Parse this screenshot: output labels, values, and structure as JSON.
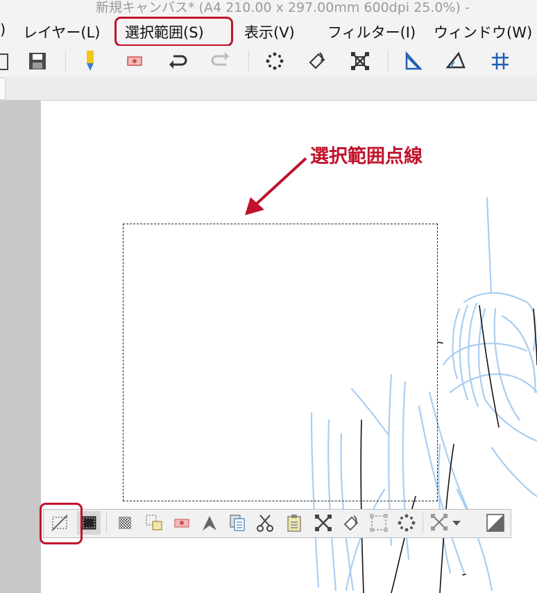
{
  "window": {
    "title": "新規キャンバス* (A4 210.00 x 297.00mm 600dpi 25.0%)  -"
  },
  "menu": {
    "items": [
      {
        "label": ")"
      },
      {
        "label": "レイヤー(L)"
      },
      {
        "label": "選択範囲(S)",
        "highlighted": true
      },
      {
        "label": "表示(V)"
      },
      {
        "label": "フィルター(I)"
      },
      {
        "label": "ウィンドウ(W)"
      }
    ]
  },
  "toolbar": {
    "icons": [
      "clipboard-icon",
      "save-icon",
      "pen-icon",
      "eraser-icon",
      "undo-icon",
      "redo-icon",
      "dots-icon",
      "fill-bucket-icon",
      "transform-icon",
      "ruler-icon",
      "ruler-angle-icon",
      "grid-icon"
    ]
  },
  "annotation": {
    "label": "選択範囲点線",
    "color": "#c0122a"
  },
  "selection_launcher": {
    "icons": [
      "deselect-icon",
      "selection-toggle-icon",
      "select-all-icon",
      "copy-paste-icon",
      "eraser-icon",
      "fill-icon",
      "duplicate-icon",
      "cut-icon",
      "paste-icon",
      "transform-icon",
      "bucket-icon",
      "expand-selection-icon",
      "shrink-selection-icon",
      "scale-dropdown-icon",
      "more-icon"
    ]
  },
  "colors": {
    "accent": "#c0122a",
    "sketch": "#a9cdf2"
  }
}
